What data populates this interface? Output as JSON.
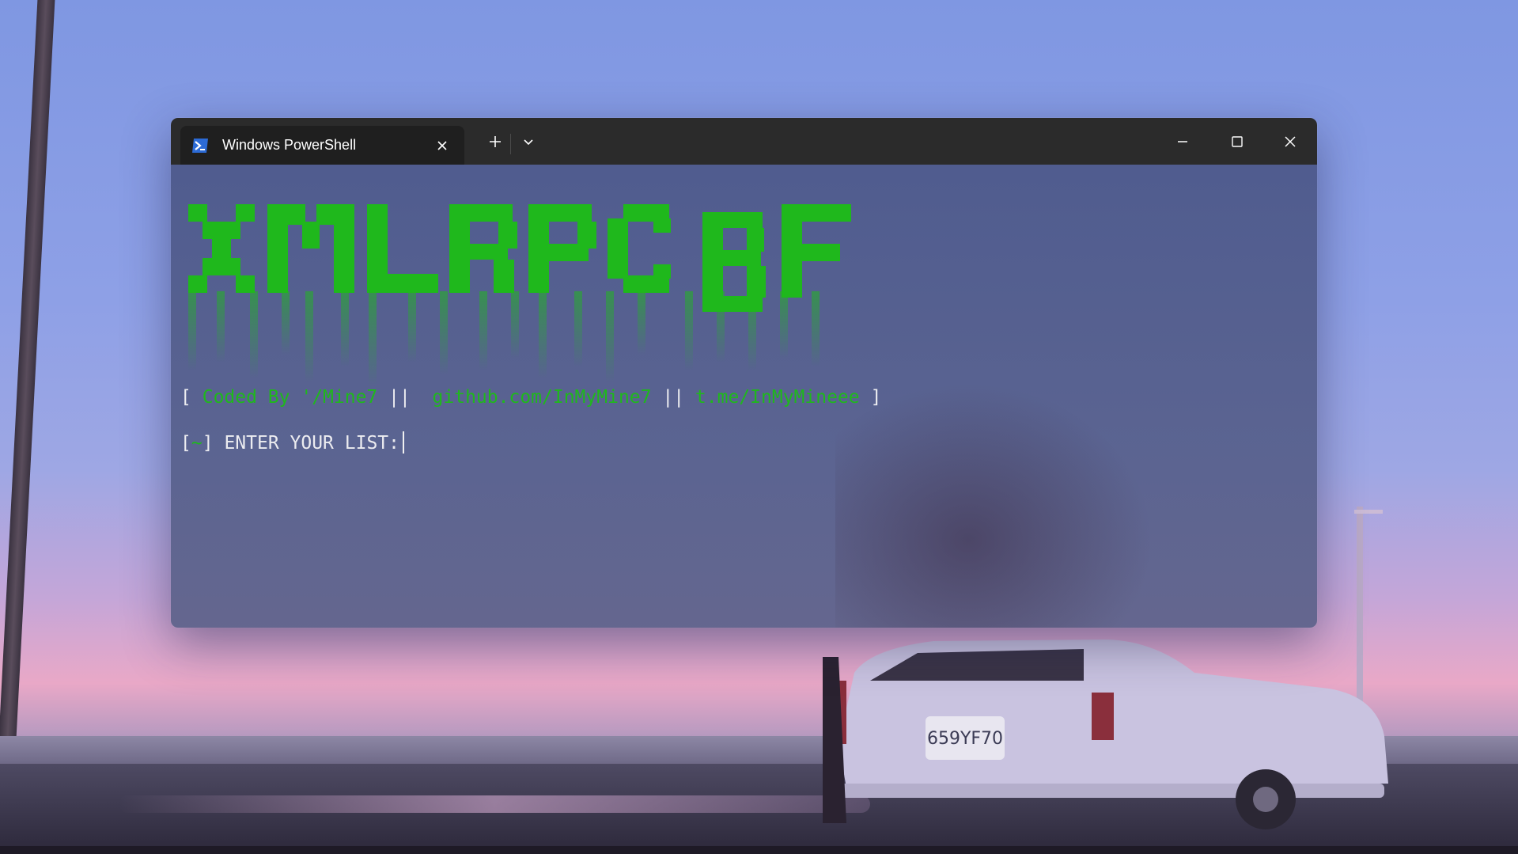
{
  "window": {
    "tab_title": "Windows PowerShell",
    "tab_icon": "powershell-icon",
    "new_tab_icon": "plus-icon",
    "dropdown_icon": "chevron-down-icon",
    "controls": [
      "minimize-icon",
      "maximize-icon",
      "close-icon"
    ]
  },
  "console": {
    "banner_text": "XMLRPC BF",
    "credit": {
      "open": "[",
      "coded_by": "Coded By '/Mine7",
      "sep1": "||",
      "github": "github.com/InMyMine7",
      "sep2": "||",
      "telegram": "t.me/InMyMineee",
      "close": "]"
    },
    "prompt": {
      "open": "[",
      "symbol": "~",
      "close": "]",
      "text": "ENTER YOUR LIST:"
    }
  },
  "colors": {
    "titlebar": "#2b2b2b",
    "tab": "#1f1f1f",
    "console_bg": "#4e5a8c",
    "accent_green": "#1fb81c",
    "text_white": "#ececf0"
  }
}
